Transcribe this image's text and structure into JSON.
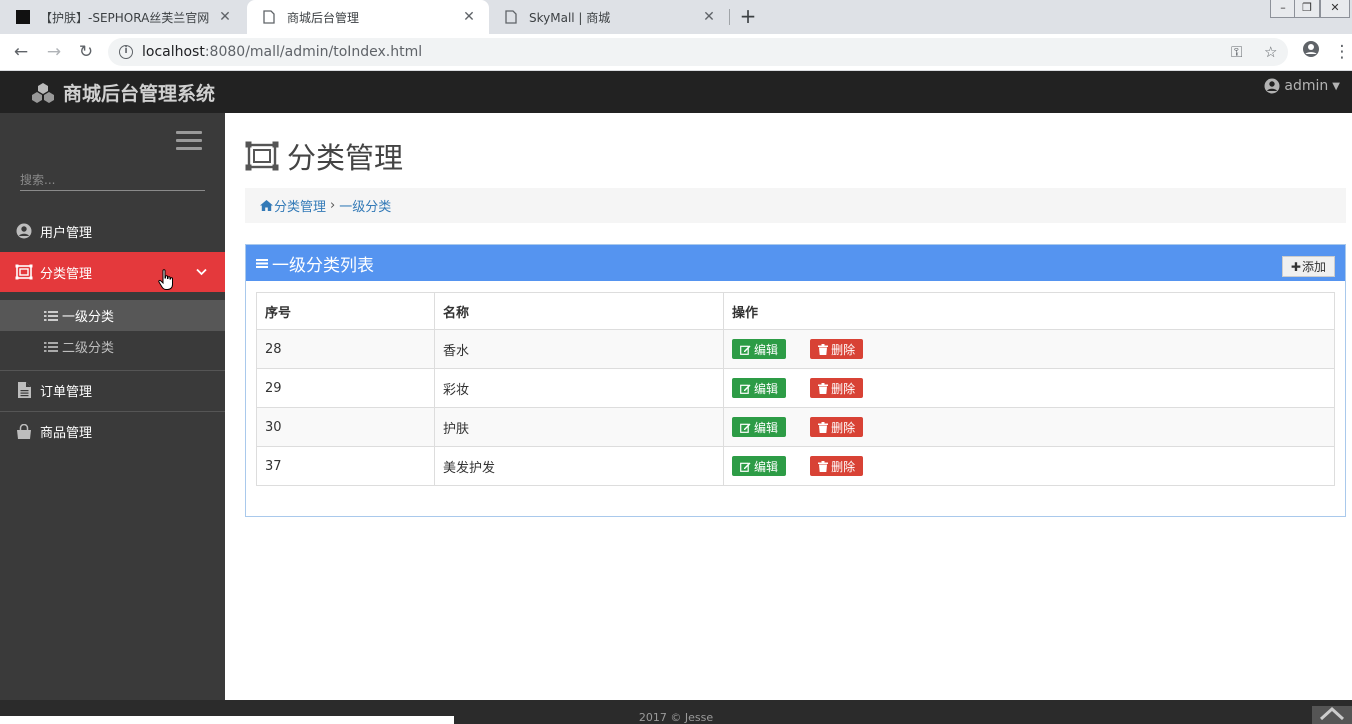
{
  "browser": {
    "tabs": [
      {
        "title": "【护肤】-SEPHORA丝芙兰官网",
        "icon": "sephora-favicon"
      },
      {
        "title": "商城后台管理",
        "icon": "page-icon"
      },
      {
        "title": "SkyMall | 商城",
        "icon": "page-icon"
      }
    ],
    "url_host": "localhost",
    "url_path": ":8080/mall/admin/toIndex.html"
  },
  "header": {
    "brand": "商城后台管理系统",
    "user": "admin"
  },
  "sidebar": {
    "search_placeholder": "搜索...",
    "items": [
      {
        "label": "用户管理",
        "icon": "user-circle-icon"
      },
      {
        "label": "分类管理",
        "icon": "category-icon"
      },
      {
        "label": "订单管理",
        "icon": "file-icon"
      },
      {
        "label": "商品管理",
        "icon": "shopping-bag-icon"
      }
    ],
    "subitems": [
      {
        "label": "一级分类"
      },
      {
        "label": "二级分类"
      }
    ]
  },
  "main": {
    "title": "分类管理",
    "breadcrumb": [
      "分类管理",
      "一级分类"
    ],
    "panel_title": "一级分类列表",
    "add_label": "添加",
    "columns": [
      "序号",
      "名称",
      "操作"
    ],
    "rows": [
      {
        "id": "28",
        "name": "香水"
      },
      {
        "id": "29",
        "name": "彩妆"
      },
      {
        "id": "30",
        "name": "护肤"
      },
      {
        "id": "37",
        "name": "美发护发"
      }
    ],
    "edit_label": "编辑",
    "delete_label": "删除"
  },
  "footer": {
    "text": "2017 © Jesse"
  },
  "colors": {
    "accent_red": "#e4393c",
    "panel_blue": "#5594f0",
    "edit_green": "#2d9c46",
    "delete_red": "#d84235"
  }
}
